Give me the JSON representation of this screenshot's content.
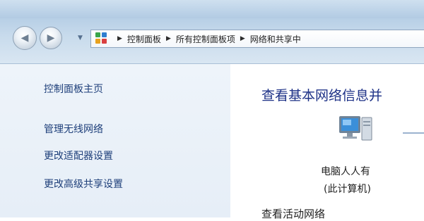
{
  "window": {
    "titlebar": ""
  },
  "nav": {
    "back_icon": "back-arrow-icon",
    "forward_icon": "forward-arrow-icon",
    "history_dropdown_icon": "chevron-down-icon"
  },
  "address": {
    "root_icon": "control-panel-icon",
    "separator": "▶",
    "breadcrumbs": [
      "控制面板",
      "所有控制面板项",
      "网络和共享中"
    ]
  },
  "sidebar": {
    "home": "控制面板主页",
    "items": [
      "管理无线网络",
      "更改适配器设置",
      "更改高级共享设置"
    ]
  },
  "main": {
    "title": "查看基本网络信息并",
    "computer_name": "电脑人人有",
    "computer_sub": "(此计算机)",
    "active_networks_label": "查看活动网络"
  },
  "colors": {
    "link": "#1e3f7a",
    "title": "#1e3287",
    "sidebar_bg": "#e6eef7"
  }
}
